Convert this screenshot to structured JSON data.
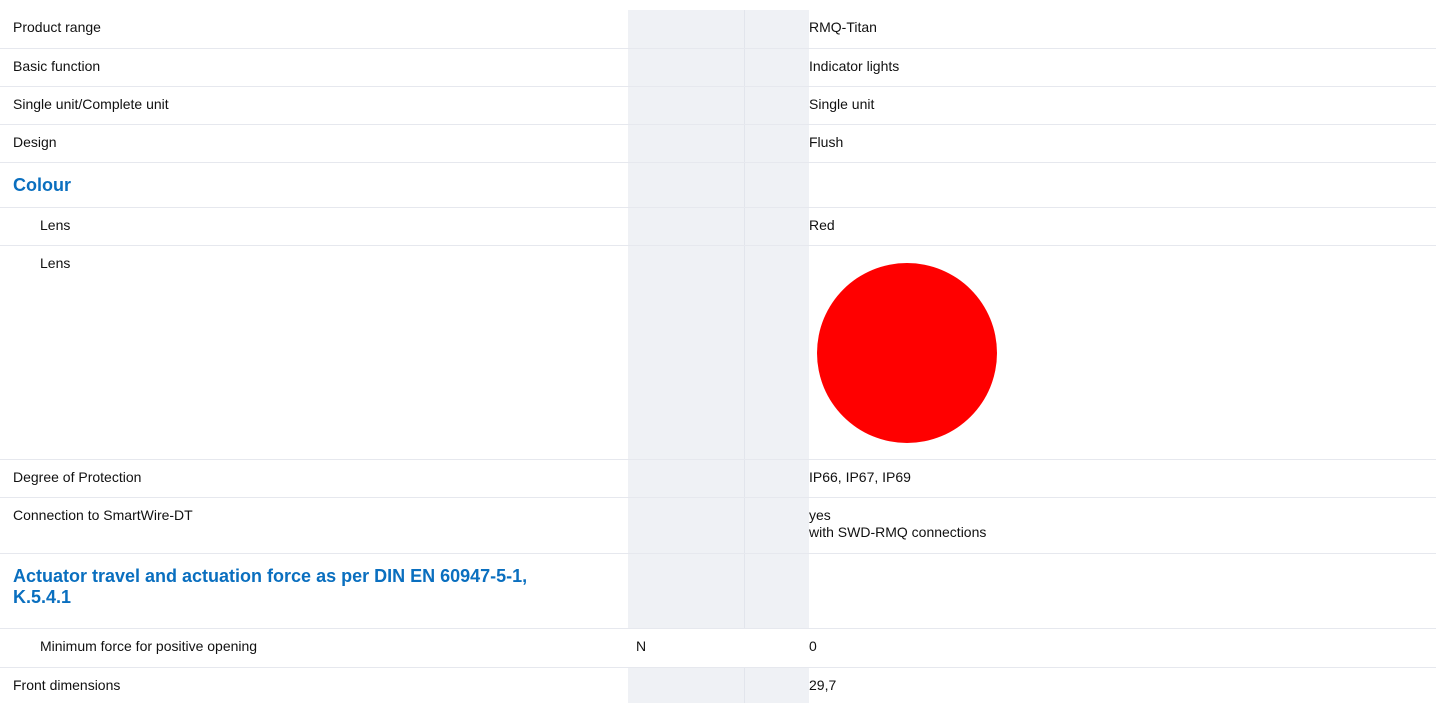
{
  "page": {
    "section_title": ""
  },
  "rows": {
    "product_range": {
      "label": "Product range",
      "unit": "",
      "value": "RMQ-Titan"
    },
    "basic_function": {
      "label": "Basic function",
      "unit": "",
      "value": "Indicator lights"
    },
    "single_complete": {
      "label": "Single unit/Complete unit",
      "unit": "",
      "value": "Single unit"
    },
    "design": {
      "label": "Design",
      "unit": "",
      "value": "Flush"
    },
    "colour_heading": {
      "label": "Colour"
    },
    "lens_text": {
      "label": "Lens",
      "unit": "",
      "value": "Red"
    },
    "lens_swatch": {
      "label": "Lens",
      "unit": "",
      "swatch_color": "#ff0000"
    },
    "degree_protection": {
      "label": "Degree of Protection",
      "unit": "",
      "value": "IP66, IP67, IP69"
    },
    "smartwire": {
      "label": "Connection to SmartWire-DT",
      "unit": "",
      "value_line1": "yes",
      "value_line2": "with SWD-RMQ connections"
    },
    "actuator_heading": {
      "label_line1": "Actuator travel and actuation force as per DIN EN 60947-5-1,",
      "label_line2": "K.5.4.1"
    },
    "min_force": {
      "label": "Minimum force for positive opening",
      "unit": "N",
      "value": "0"
    },
    "front_dimensions": {
      "label": "Front dimensions",
      "unit": "",
      "value": "29,7"
    }
  },
  "colors": {
    "heading": "#0a6fbf",
    "unit_column_bg": "#eff1f5",
    "row_border": "#e6e8ee",
    "lens_red": "#ff0000"
  }
}
